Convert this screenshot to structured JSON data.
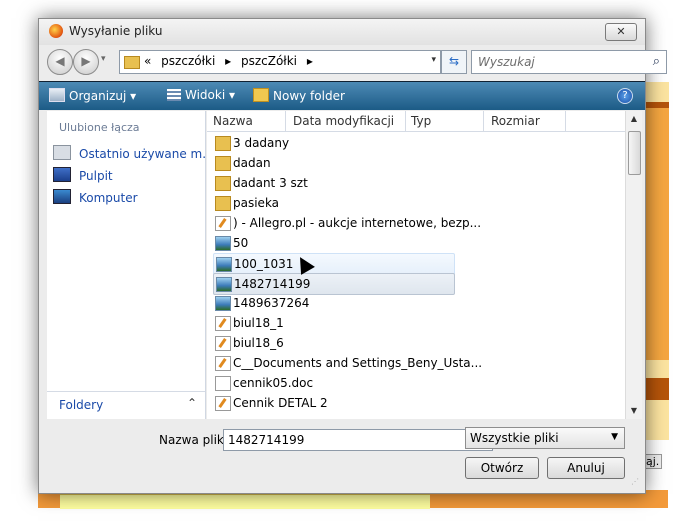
{
  "window": {
    "title": "Wysyłanie pliku",
    "close_label": "✕"
  },
  "address": {
    "prefix": "«",
    "crumb1": "pszczółki",
    "sep": "▸",
    "crumb2": "pszcZółki",
    "sep2": "▸",
    "dropdown": "▾"
  },
  "search": {
    "placeholder": "Wyszukaj",
    "icon": "⌕"
  },
  "toolbar": {
    "organize": "Organizuj ▾",
    "views": "Widoki ▾",
    "new_folder": "Nowy folder",
    "help": "?"
  },
  "favorites": {
    "header": "Ulubione łącza",
    "items": [
      {
        "label": "Ostatnio używane m...",
        "icon": "recent-places-icon"
      },
      {
        "label": "Pulpit",
        "icon": "desktop-icon"
      },
      {
        "label": "Komputer",
        "icon": "computer-icon"
      }
    ]
  },
  "folders_bar": {
    "label": "Foldery",
    "chevron": "⌃"
  },
  "columns": [
    "Nazwa",
    "Data modyfikacji",
    "Typ",
    "Rozmiar"
  ],
  "files": [
    {
      "name": "3 dadany",
      "icon": "folder-icon"
    },
    {
      "name": "dadan",
      "icon": "folder-icon"
    },
    {
      "name": "dadant 3 szt",
      "icon": "folder-icon"
    },
    {
      "name": "pasieka",
      "icon": "folder-icon"
    },
    {
      "name": ") - Allegro.pl - aukcje internetowe, bezp...",
      "icon": "edit-document-icon"
    },
    {
      "name": "50",
      "icon": "image-icon"
    },
    {
      "name": "100_1031",
      "icon": "image-icon"
    },
    {
      "name": "1482714199",
      "icon": "image-icon"
    },
    {
      "name": "1489637264",
      "icon": "image-icon"
    },
    {
      "name": "biul18_1",
      "icon": "edit-document-icon"
    },
    {
      "name": "biul18_6",
      "icon": "edit-document-icon"
    },
    {
      "name": "C__Documents and Settings_Beny_Usta...",
      "icon": "edit-document-icon"
    },
    {
      "name": "cennik05.doc",
      "icon": "document-icon"
    },
    {
      "name": "Cennik DETAL 2",
      "icon": "edit-document-icon"
    }
  ],
  "footer": {
    "filename_label": "Nazwa pliku:",
    "filename_value": "1482714199",
    "filetype_value": "Wszystkie pliki",
    "open_label": "Otwórz",
    "cancel_label": "Anuluj"
  },
  "background": {
    "right_label": "ąj."
  }
}
